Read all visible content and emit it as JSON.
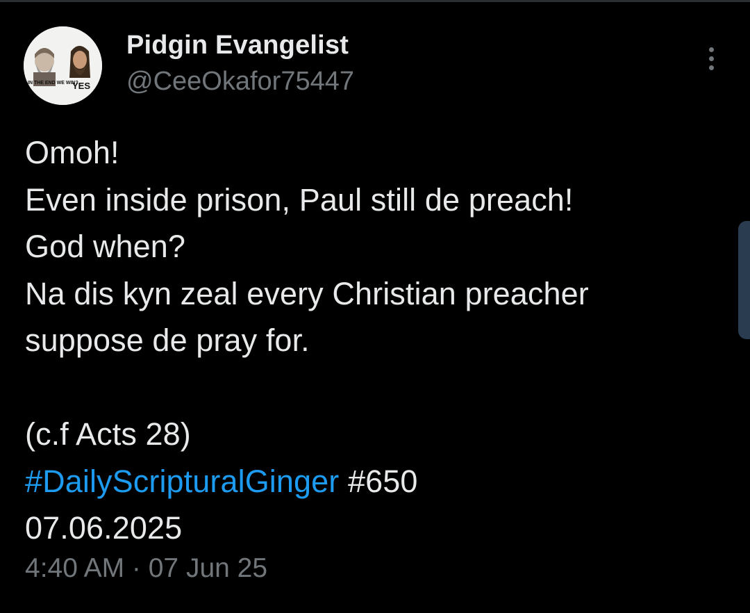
{
  "tweet": {
    "display_name": "Pidgin Evangelist",
    "handle": "@CeeOkafor75447",
    "avatar": {
      "caption_left": "IN THE END WE WIN?",
      "caption_right": "YES"
    },
    "body_lines": [
      "Omoh!",
      "Even inside prison, Paul still de preach!",
      "God when?",
      "Na dis kyn zeal every Christian preacher",
      "suppose de pray for."
    ],
    "reference": "(c.f Acts 28)",
    "hashtag": "#DailyScripturalGinger",
    "number_tag": "#650",
    "date_line": "07.06.2025",
    "timestamp": "4:40 AM · 07 Jun 25"
  },
  "icons": {
    "more": "more-vertical-icon"
  },
  "colors": {
    "background": "#000000",
    "text_primary": "#e7e9ea",
    "text_secondary": "#71767b",
    "link": "#1d9bf0",
    "scroll_handle": "#2a3d50"
  }
}
